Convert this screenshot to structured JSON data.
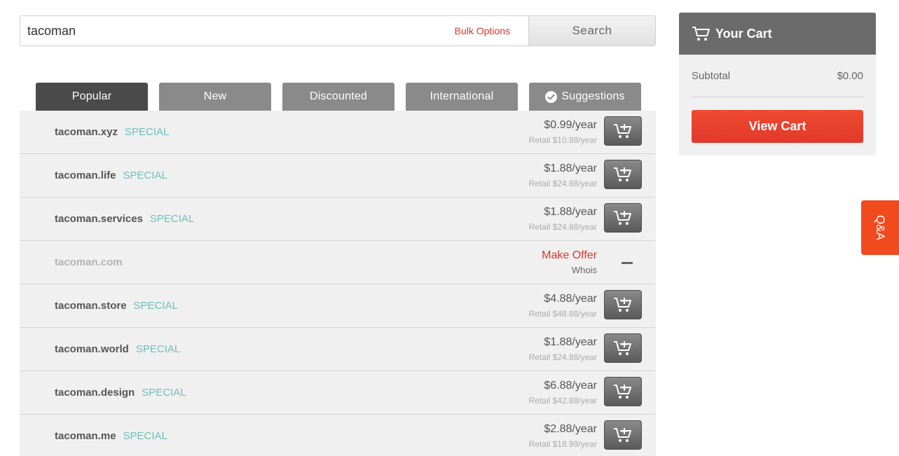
{
  "search": {
    "value": "tacoman",
    "bulk_options_label": "Bulk Options",
    "button_label": "Search"
  },
  "tabs": [
    {
      "label": "Popular",
      "active": true
    },
    {
      "label": "New",
      "active": false
    },
    {
      "label": "Discounted",
      "active": false
    },
    {
      "label": "International",
      "active": false
    },
    {
      "label": "Suggestions",
      "active": false,
      "icon": "checkmark-circle-icon"
    }
  ],
  "results": [
    {
      "domain": "tacoman.xyz",
      "tag": "SPECIAL",
      "price": "$0.99/year",
      "retail": "Retail $10.88/year",
      "available": true
    },
    {
      "domain": "tacoman.life",
      "tag": "SPECIAL",
      "price": "$1.88/year",
      "retail": "Retail $24.88/year",
      "available": true
    },
    {
      "domain": "tacoman.services",
      "tag": "SPECIAL",
      "price": "$1.88/year",
      "retail": "Retail $24.88/year",
      "available": true
    },
    {
      "domain": "tacoman.com",
      "tag": "",
      "offer": "Make Offer",
      "whois": "Whois",
      "available": false
    },
    {
      "domain": "tacoman.store",
      "tag": "SPECIAL",
      "price": "$4.88/year",
      "retail": "Retail $48.88/year",
      "available": true
    },
    {
      "domain": "tacoman.world",
      "tag": "SPECIAL",
      "price": "$1.88/year",
      "retail": "Retail $24.88/year",
      "available": true
    },
    {
      "domain": "tacoman.design",
      "tag": "SPECIAL",
      "price": "$6.88/year",
      "retail": "Retail $42.88/year",
      "available": true
    },
    {
      "domain": "tacoman.me",
      "tag": "SPECIAL",
      "price": "$2.88/year",
      "retail": "Retail $18.99/year",
      "available": true
    }
  ],
  "cart": {
    "title": "Your Cart",
    "subtotal_label": "Subtotal",
    "subtotal_value": "$0.00",
    "view_cart_label": "View Cart"
  },
  "qa_tab": {
    "label": "Q&A"
  },
  "colors": {
    "accent_red": "#e0392a",
    "special_teal": "#6dbfb8",
    "tab_active": "#4a4a4a",
    "tab_inactive": "#8a8a8a"
  },
  "icons": {
    "cart_header": "cart-icon",
    "add_to_cart": "add-to-cart-icon",
    "suggestions": "checkmark-circle-icon"
  }
}
